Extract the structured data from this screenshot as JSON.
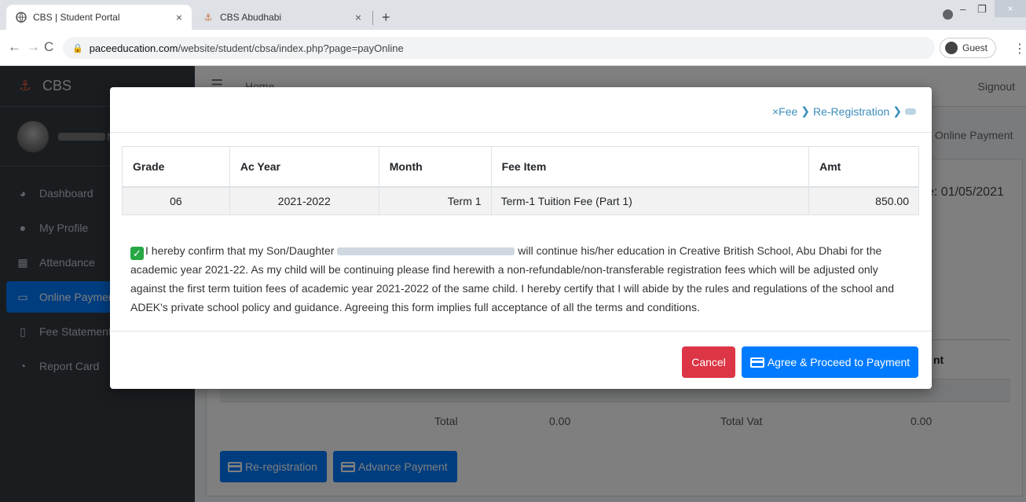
{
  "browser": {
    "tabs": [
      {
        "label": "CBS | Student Portal",
        "active": true
      },
      {
        "label": "CBS Abudhabi",
        "active": false
      }
    ],
    "url_domain": "paceeducation.com",
    "url_path": "/website/student/cbsa/index.php?page=payOnline",
    "profile_label": "Guest"
  },
  "app": {
    "brand": "CBS",
    "topnav": {
      "home": "Home",
      "signout": "Signout"
    },
    "user_name_tail": "M F",
    "sidebar": {
      "items": [
        {
          "label": "Dashboard",
          "icon": "dashboard-icon"
        },
        {
          "label": "My Profile",
          "icon": "user-icon"
        },
        {
          "label": "Attendance",
          "icon": "calendar-icon"
        },
        {
          "label": "Online Payment",
          "icon": "credit-card-icon",
          "active": true
        },
        {
          "label": "Fee Statement",
          "icon": "file-icon"
        },
        {
          "label": "Report Card",
          "icon": "pie-chart-icon"
        }
      ]
    },
    "breadcrumb_current": "Online Payment",
    "due_date": "e: 01/05/2021",
    "background_table": {
      "total_label": "Total",
      "total_value": "0.00",
      "total_vat_label": "Total Vat",
      "total_vat_value": "0.00",
      "amt_header_tail": "nt"
    },
    "bottom_buttons": {
      "reregistration": "Re-registration",
      "advance": "Advance Payment"
    }
  },
  "modal": {
    "breadcrumb": {
      "close": "×",
      "fee": "Fee",
      "reregistration": "Re-Registration"
    },
    "table": {
      "headers": [
        "Grade",
        "Ac Year",
        "Month",
        "Fee Item",
        "Amt"
      ],
      "rows": [
        [
          "06",
          "2021-2022",
          "Term 1",
          "Term-1 Tuition Fee (Part 1)",
          "850.00"
        ]
      ]
    },
    "confirm": {
      "checked": true,
      "text_before": "I hereby confirm that my Son/Daughter",
      "text_after": "will continue his/her education in Creative British School, Abu Dhabi for the academic year 2021-22. As my child will be continuing please find herewith a non-refundable/non-transferable registration fees which will be adjusted only against the first term tuition fees of academic year 2021-2022 of the same child. I hereby certify that I will abide by the rules and regulations of the school and ADEK's private school policy and guidance. Agreeing this form implies full acceptance of all the terms and conditions."
    },
    "buttons": {
      "cancel": "Cancel",
      "agree": "Agree & Proceed to Payment"
    }
  },
  "colors": {
    "primary": "#007bff",
    "danger": "#dc3545",
    "success": "#28a745",
    "sidebar": "#343a40"
  }
}
